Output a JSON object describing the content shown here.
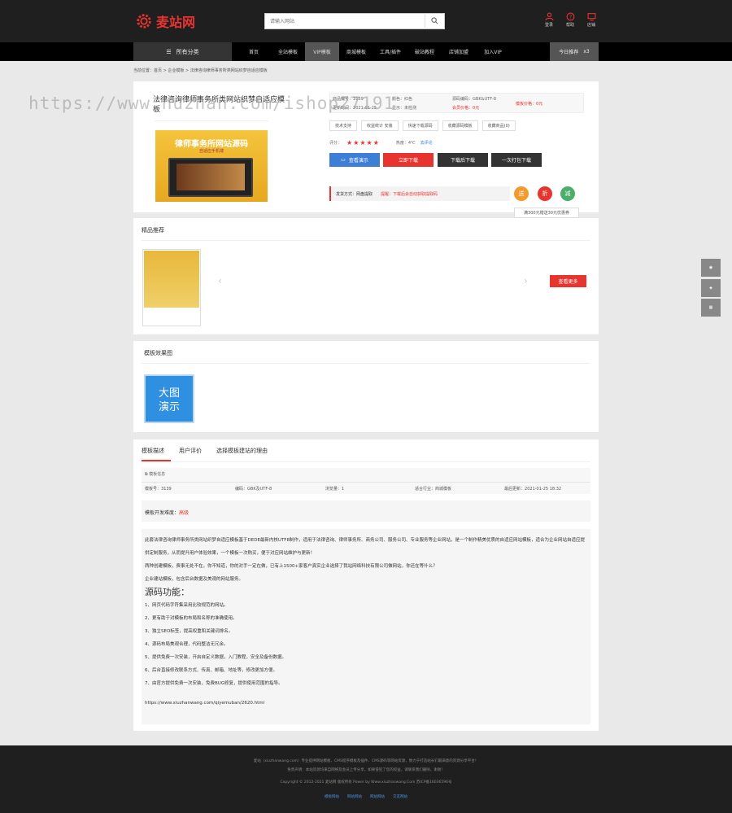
{
  "header": {
    "logo_text": "麦站网",
    "search_placeholder": "请输入网站",
    "icons": [
      {
        "name": "user-icon",
        "label": "登录"
      },
      {
        "name": "help-icon",
        "label": "帮助"
      },
      {
        "name": "screen-icon",
        "label": "店铺"
      }
    ]
  },
  "nav": {
    "all_label": "所有分类",
    "items": [
      "首页",
      "全站模板",
      "VIP模板",
      "商城模板",
      "工具/插件",
      "破站教程",
      "店铺加盟",
      "加入VIP"
    ],
    "active_index": 2,
    "today_label": "今日推荐",
    "today_count": "x3"
  },
  "breadcrumb": "当前位置：首页 > 企业模板 > 法律咨询律师事务所类网站织梦自适应模板",
  "product": {
    "title": "法律咨询律师事务所类网站织梦自适应模板",
    "thumb_title": "律师事务所网站源码",
    "thumb_sub": "自适应手机端",
    "props": [
      {
        "k": "商品编号",
        "v": "3139"
      },
      {
        "k": "颜色",
        "v": "红色"
      },
      {
        "k": "源码编码",
        "v": "GBK&UTF-8"
      },
      {
        "k": "更新时间",
        "v": "2021-01-25"
      },
      {
        "k": "显示",
        "v": "未检测"
      },
      {
        "k": "会员价格",
        "v": "0元"
      },
      {
        "k": "模板价格",
        "v": "0元"
      }
    ],
    "tags": [
      "技术支持",
      "收益统计 安装",
      "快速下载源码",
      "收藏源码模板",
      "收藏商品(0)"
    ],
    "rating_label": "评分：",
    "rating_stars": "★★★★★",
    "rating_text": "热度：4℃",
    "rating_link": "去评论",
    "buttons": [
      "查看演示",
      "立即下载",
      "下载后下载",
      "一次打包下载"
    ],
    "ship_label": "发货方式：网盘提取",
    "ship_note": "提醒：下载后会自动获取提取码",
    "circles": [
      "送",
      "折",
      "减"
    ],
    "tip": "满300元赠送30元优惠券"
  },
  "recommend": {
    "title": "精品推荐",
    "more_label": "查看更多"
  },
  "preview": {
    "title": "模板效果图",
    "demo_line1": "大图",
    "demo_line2": "演示"
  },
  "detail": {
    "tabs": [
      "模板描述",
      "用户评价",
      "选择模板建站的理由"
    ],
    "info_head": "模板信息",
    "info": [
      {
        "k": "模板号：",
        "v": "3139"
      },
      {
        "k": "编码：",
        "v": "GBK及UTF-8"
      },
      {
        "k": "浏览量：",
        "v": "1"
      },
      {
        "k": "适合行业：",
        "v": "商城模板"
      },
      {
        "k": "最后更新：",
        "v": "2021-01-25 18:32"
      }
    ],
    "dev_label": "模板开发难度：",
    "dev_value": "高级",
    "paras": [
      "此套法律咨询律师事务所类网站织梦自适应模板基于DEDE最新内核UTF8制作，适用于法律咨询、律师事务所、商务公司、服务公司、专业服务等企业网站，是一个制作精美优质的自适应网站模板，适合为企业网站自适应提供定制服务，从而提升用户体验效果，一个模板一次购买，便于对应网站维护与更新！",
      "两种创建模板，费事无处不在，你不知道，你的对手一定在做，已有上1500+家客户真实企业选择了我站网络科技有限公司做网站，你还在等什么？",
      "企业建站模板，包含后台数据及美观的网站服务。"
    ],
    "func_title": "源码功能：",
    "funcs": [
      "1、网页代码字符集采用比较规范的网站。",
      "2、更有助于对模板的布局和名称的准确使用。",
      "3、独立SEO标签，提高权重和关键词排名。",
      "4、源码布局美观合理，代码整洁无冗余。",
      "5、提供免费一次安装，开启自定义数据，入门教程，安全及备份数据。",
      "6、后台直接修改联系方式、传真、邮箱、地址等，修改更加方便。",
      "7、由官方提供免费一次安装，免费BUG修复，提供使用范围的指导。"
    ],
    "link": "https://www.xiuzhanwang.com/qiyemuban/2620.html"
  },
  "footer": {
    "line1": "麦站（xiuzhanwang.com）专业提供网站模板、CMS程序模板及插件、CMS源码等网站资源，致力于打造站长们最满意的资源分享平台！",
    "line2": "免责声明：本站资源均来自网络及会员上传分享，如果侵犯了您的权益，请联系我们删除，谢谢！",
    "line3": "Copyright © 2012-2021 麦站网 版权所有 Power by Www.xiuzhanwang.Com  苏ICP备16036596号",
    "links": [
      "模板网站",
      "网站网站",
      "网站网站",
      "交友网站"
    ]
  },
  "watermark": "https://www.huzhan.com/ishop27191"
}
